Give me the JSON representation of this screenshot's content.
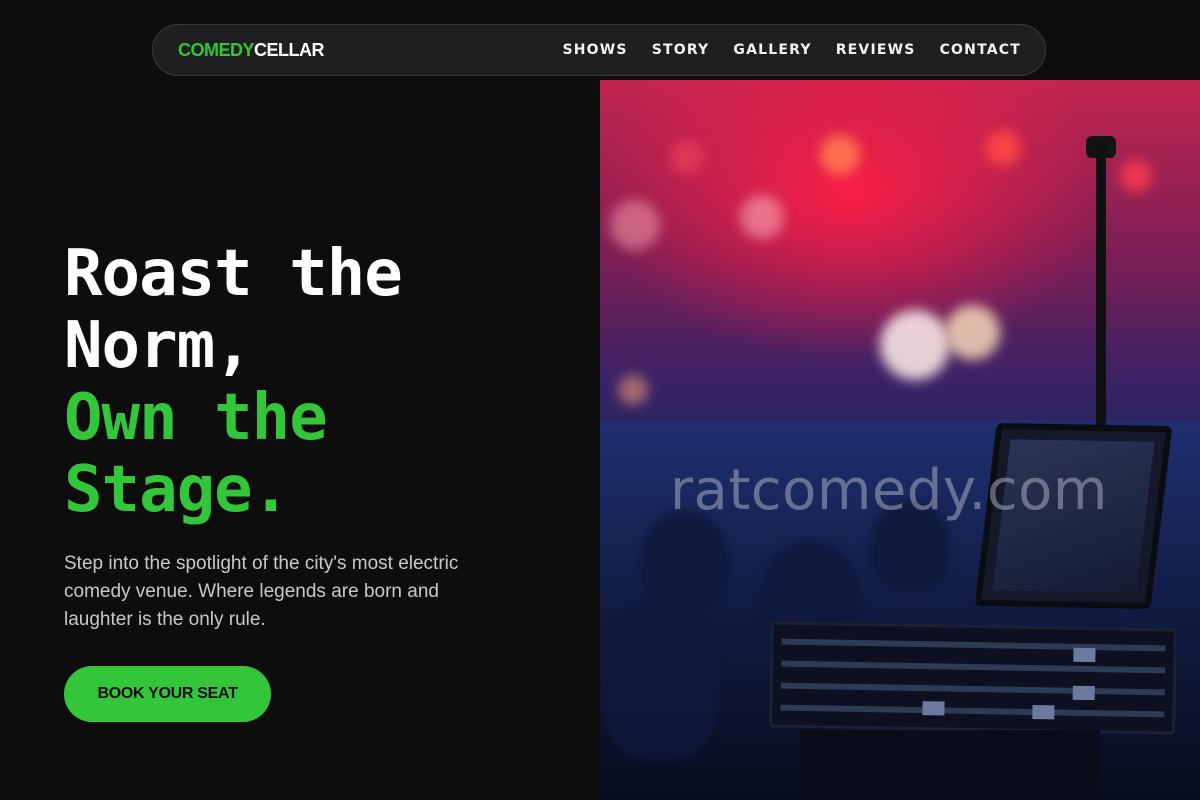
{
  "brand": {
    "logo_part1": "COMEDY",
    "logo_part2": "CELLAR",
    "accent_color": "#33c63a"
  },
  "nav": {
    "links": [
      "SHOWS",
      "STORY",
      "GALLERY",
      "REVIEWS",
      "CONTACT"
    ]
  },
  "hero": {
    "title_white_line1": "Roast the",
    "title_white_line2": "Norm,",
    "title_green_line1": "Own the",
    "title_green_line2": "Stage.",
    "description": "Step into the spotlight of the city's most electric comedy venue. Where legends are born and laughter is the only rule.",
    "cta_label": "BOOK YOUR SEAT"
  },
  "image": {
    "watermark": "ratcomedy.com"
  }
}
